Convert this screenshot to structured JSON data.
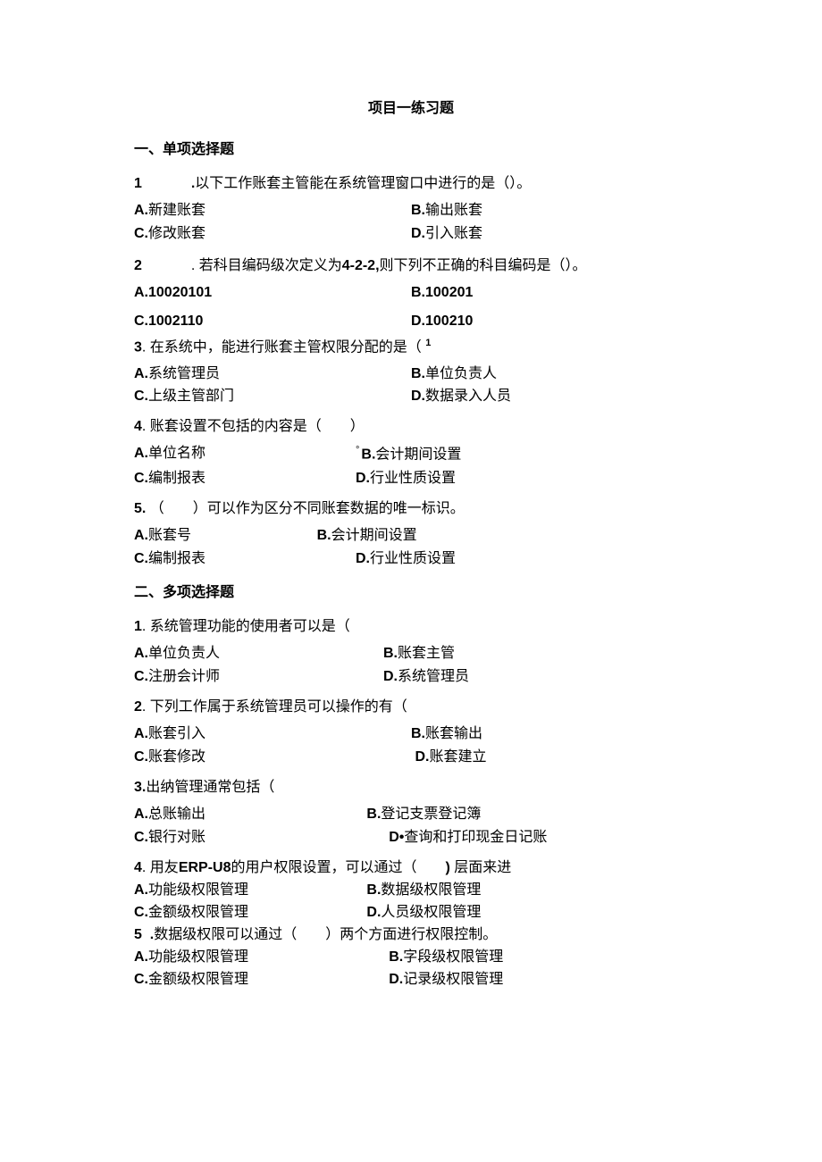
{
  "title": "项目一练习题",
  "section1_heading": "一、单项选择题",
  "section2_heading": "二、多项选择题",
  "s1": {
    "q1": {
      "num": "1",
      "sep": ".",
      "text": "以下工作账套主管能在系统管理窗口中进行的是（）。",
      "A_letter": "A.",
      "A_text": "新建账套",
      "B_letter": "B.",
      "B_text": "输出账套",
      "C_letter": "C.",
      "C_text": "修改账套",
      "D_letter": "D.",
      "D_text": "引入账套"
    },
    "q2": {
      "num": "2",
      "text": ". 若科目编码级次定义为",
      "code": "4-2-2,",
      "text2": "则下列不正确的科目编码是（）。",
      "A_letter": "A.",
      "A_text": "10020101",
      "B_letter": "B.",
      "B_text": "100201",
      "C_letter": "C.",
      "C_text": "1002110",
      "D_letter": "D.",
      "D_text": "100210"
    },
    "q3": {
      "num": "3",
      "text": ". 在系统中，能进行账套主管权限分配的是（",
      "sup": "1",
      "A_letter": "A.",
      "A_text": "系统管理员",
      "B_letter": "B.",
      "B_text": "单位负责人",
      "C_letter": "C.",
      "C_text": "上级主管部门",
      "D_letter": "D.",
      "D_text": "数据录入人员"
    },
    "q4": {
      "num": "4",
      "text": ". 账套设置不包括的内容是（　　）",
      "A_letter": "A.",
      "A_text": "单位名称",
      "B_mark": "°",
      "B_letter": "B.",
      "B_text": "会计期间设置",
      "C_letter": "C.",
      "C_text": "编制报表",
      "D_letter": "D.",
      "D_text": "行业性质设置"
    },
    "q5": {
      "num": "5.",
      "text": "（　　）可以作为区分不同账套数据的唯一标识。",
      "A_letter": "A.",
      "A_text": "账套号",
      "B_letter": "B.",
      "B_text": "会计期间设置",
      "C_letter": "C.",
      "C_text": "编制报表",
      "D_letter": "D.",
      "D_text": "行业性质设置"
    }
  },
  "s2": {
    "q1": {
      "num": "1",
      "text": ". 系统管理功能的使用者可以是（",
      "A_letter": "A.",
      "A_text": "单位负责人",
      "B_letter": "B.",
      "B_text": "账套主管",
      "C_letter": "C.",
      "C_text": "注册会计师",
      "D_letter": "D.",
      "D_text": "系统管理员"
    },
    "q2": {
      "num": "2",
      "text": ". 下列工作属于系统管理员可以操作的有（",
      "A_letter": "A.",
      "A_text": "账套引入",
      "B_letter": "B.",
      "B_text": "账套输出",
      "C_letter": "C.",
      "C_text": "账套修改",
      "D_letter": "D.",
      "D_text": "账套建立"
    },
    "q3": {
      "num": "3.",
      "text": "出纳管理通常包括（",
      "A_letter": "A.",
      "A_text": "总账输出",
      "B_letter": "B.",
      "B_text": "登记支票登记簿",
      "C_letter": "C.",
      "C_text": "银行对账",
      "D_letter": "D•",
      "D_text": "查询和打印现金日记账"
    },
    "q4": {
      "num": "4",
      "text_a": ". 用友",
      "erp": "ERP-U8",
      "text_b": "的用户权限设置，可以通过（　　",
      "paren": ")",
      "text_c": " 层面来进",
      "A_letter": "A.",
      "A_text": "功能级权限管理",
      "B_letter": "B.",
      "B_text": "数据级权限管理",
      "C_letter": "C.",
      "C_text": "金额级权限管理",
      "D_letter": "D.",
      "D_text": "人员级权限管理"
    },
    "q5": {
      "num": "5",
      "sep": ".",
      "text": "数据级权限可以通过（　　）两个方面进行权限控制。",
      "A_letter": "A.",
      "A_text": "功能级权限管理",
      "B_letter": "B.",
      "B_text": "字段级权限管理",
      "C_letter": "C.",
      "C_text": "金额级权限管理",
      "D_letter": "D.",
      "D_text": "记录级权限管理"
    }
  }
}
